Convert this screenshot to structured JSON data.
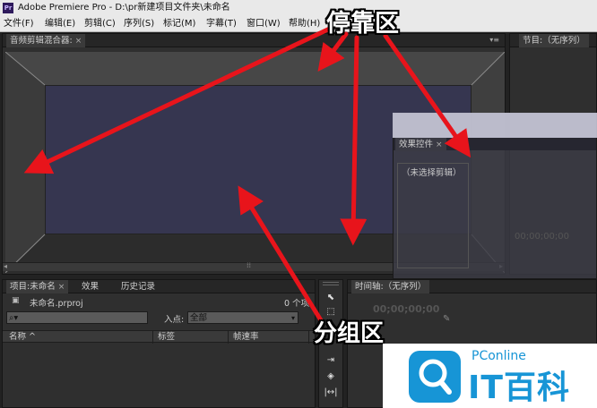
{
  "window": {
    "title": "Adobe Premiere Pro - D:\\pr新建项目文件夹\\未命名",
    "app_icon_text": "Pr"
  },
  "menu": [
    {
      "label": "文件(F)"
    },
    {
      "label": "编辑(E)"
    },
    {
      "label": "剪辑(C)"
    },
    {
      "label": "序列(S)"
    },
    {
      "label": "标记(M)"
    },
    {
      "label": "字幕(T)"
    },
    {
      "label": "窗口(W)"
    },
    {
      "label": "帮助(H)"
    }
  ],
  "panels": {
    "audio_mixer": {
      "tab": "音频剪辑混合器:",
      "close": "×"
    },
    "program": {
      "tab": "节目:（无序列）"
    },
    "effect_controls": {
      "tab": "效果控件",
      "close": "×",
      "no_clip": "（未选择剪辑）",
      "timecode": "00;00;00;00"
    },
    "project": {
      "tabs": [
        "项目:未命名",
        "效果",
        "历史记录"
      ],
      "close": "×",
      "file": "未命名.prproj",
      "item_count": "0 个项",
      "search_placeholder": "",
      "in_point_label": "入点:",
      "in_point_value": "全部",
      "columns": [
        "名称 ^",
        "标签",
        "帧速率"
      ]
    },
    "timeline": {
      "tab": "时间轴:（无序列）",
      "timecode": "00;00;00;00"
    }
  },
  "annotations": {
    "dock_zone": "停靠区",
    "group_zone": "分组区"
  },
  "watermark": {
    "brand": "PConline",
    "name": "IT百科"
  },
  "colors": {
    "annotation_arrow": "#e8141b",
    "panel_bg": "#2f2f2f",
    "mixer_inner": "#363650",
    "watermark_blue": "#1795d6"
  }
}
